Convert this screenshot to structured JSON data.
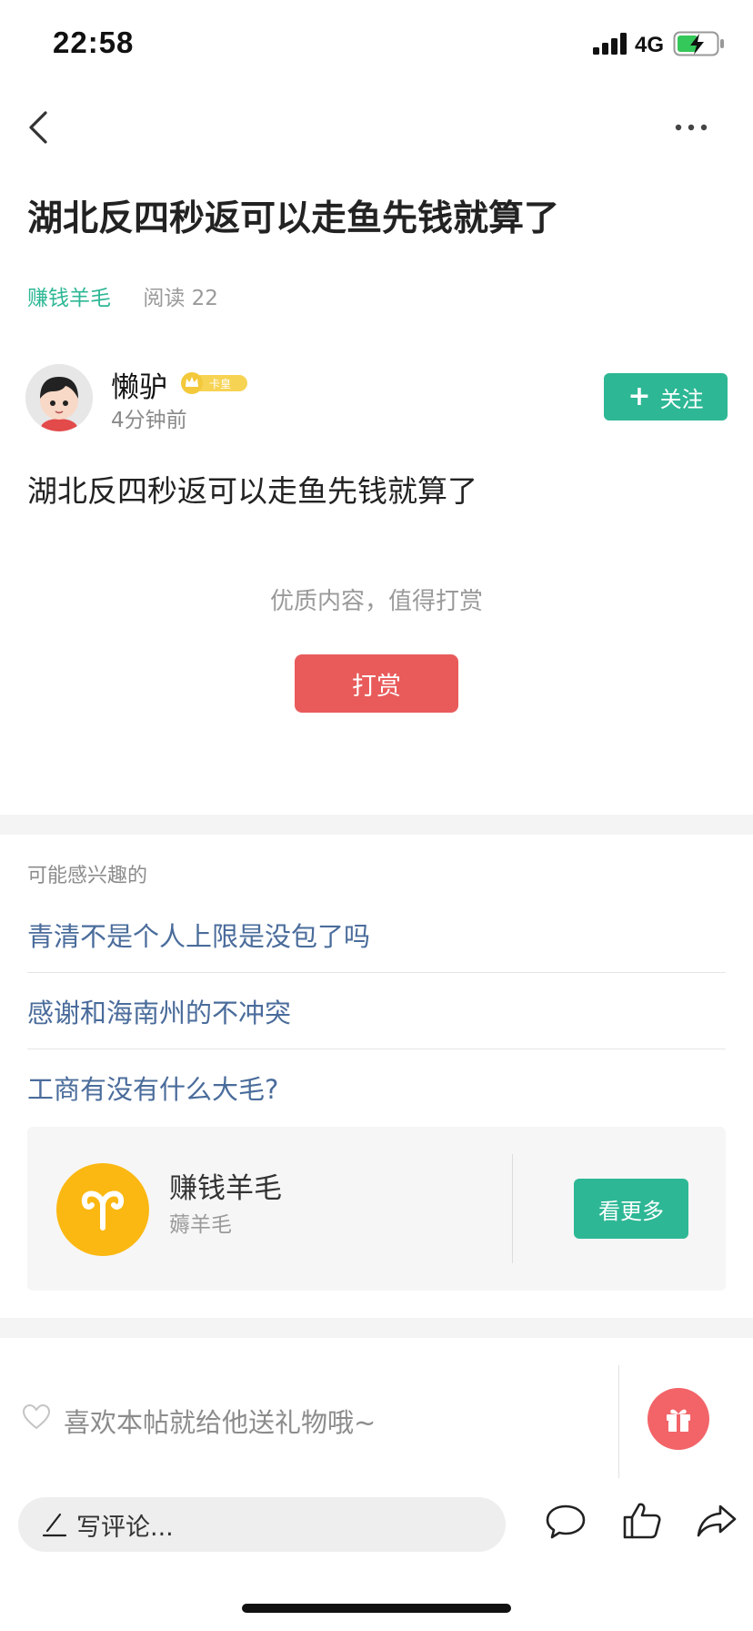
{
  "status_bar": {
    "time": "22:58",
    "network": "4G",
    "battery_color": "#34c759"
  },
  "nav": {
    "back_icon": "chevron-left-icon",
    "more_icon": "more-dots-icon"
  },
  "post": {
    "title": "湖北反四秒返可以走鱼先钱就算了",
    "topic": "赚钱羊毛",
    "reads": "阅读 22",
    "author": {
      "name": "懒驴",
      "badge": "卡皇",
      "time": "4分钟前"
    },
    "follow_label": "关注",
    "content": "湖北反四秒返可以走鱼先钱就算了"
  },
  "reward": {
    "hint": "优质内容，值得打赏",
    "button_label": "打赏",
    "button_color": "#e95b5b"
  },
  "related": {
    "title": "可能感兴趣的",
    "items": [
      "青清不是个人上限是没包了吗",
      "感谢和海南州的不冲突",
      "工商有没有什么大毛?"
    ]
  },
  "topic_card": {
    "name": "赚钱羊毛",
    "subtitle": "薅羊毛",
    "see_more_label": "看更多",
    "logo_color": "#fbb812"
  },
  "gift": {
    "text": "喜欢本帖就给他送礼物哦~",
    "icon": "gift-icon"
  },
  "comment_bar": {
    "placeholder": "写评论...",
    "icons": [
      "comment-icon",
      "like-icon",
      "share-icon"
    ]
  },
  "colors": {
    "accent": "#2db795",
    "link": "#4a6c9b"
  }
}
